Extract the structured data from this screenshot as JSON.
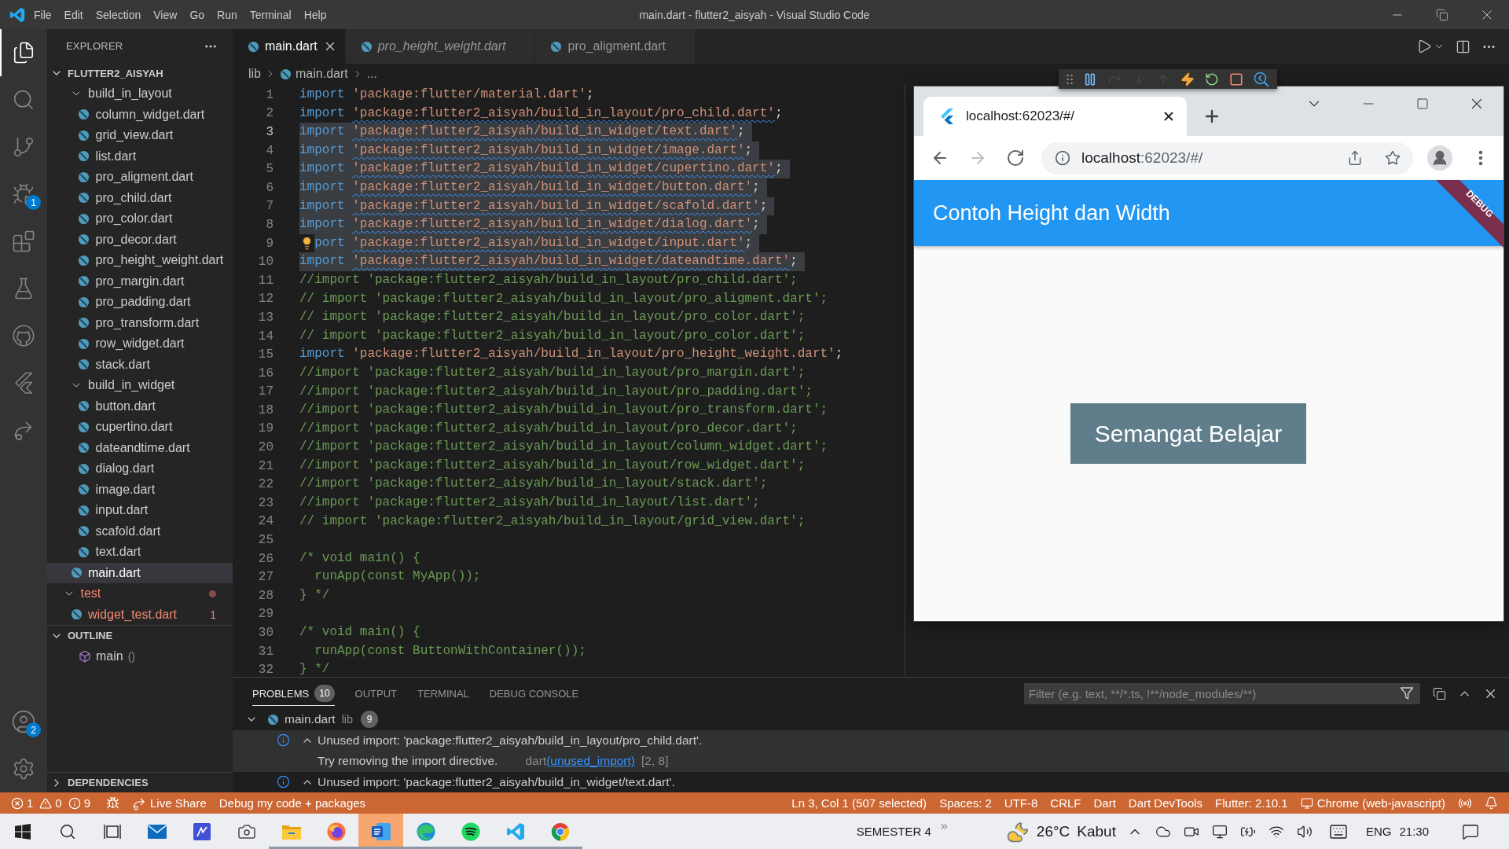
{
  "window": {
    "title": "main.dart - flutter2_aisyah - Visual Studio Code"
  },
  "menu": [
    "File",
    "Edit",
    "Selection",
    "View",
    "Go",
    "Run",
    "Terminal",
    "Help"
  ],
  "activity_bar": [
    {
      "kind": "explorer",
      "selected": true
    },
    {
      "kind": "search",
      "selected": false
    },
    {
      "kind": "source_control",
      "selected": false
    },
    {
      "kind": "run_debug",
      "selected": false,
      "badge": "1"
    },
    {
      "kind": "extensions",
      "selected": false
    },
    {
      "kind": "testing",
      "selected": false
    },
    {
      "kind": "github",
      "selected": false
    },
    {
      "kind": "flutter",
      "selected": false
    },
    {
      "kind": "live_share",
      "selected": false
    }
  ],
  "activity_bar_bottom": [
    {
      "kind": "accounts",
      "badge": "2"
    },
    {
      "kind": "manage"
    }
  ],
  "explorer": {
    "title": "EXPLORER",
    "project": {
      "label": "FLUTTER2_AISYAH",
      "expanded": true
    },
    "tree": [
      {
        "children": [
          {
            "label": "build_in_layout",
            "kind": "folder",
            "expanded": true,
            "selected": false,
            "error": false,
            "children": [
              {
                "label": "column_widget.dart",
                "kind": "file",
                "selected": false,
                "error": false
              },
              {
                "label": "grid_view.dart",
                "kind": "file",
                "selected": false,
                "error": false
              },
              {
                "label": "list.dart",
                "kind": "file",
                "selected": false,
                "error": false
              },
              {
                "label": "pro_aligment.dart",
                "kind": "file",
                "selected": false,
                "error": false
              },
              {
                "label": "pro_child.dart",
                "kind": "file",
                "selected": false,
                "error": false
              },
              {
                "label": "pro_color.dart",
                "kind": "file",
                "selected": false,
                "error": false
              },
              {
                "label": "pro_decor.dart",
                "kind": "file",
                "selected": false,
                "error": false
              },
              {
                "label": "pro_height_weight.dart",
                "kind": "file",
                "selected": false,
                "error": false
              },
              {
                "label": "pro_margin.dart",
                "kind": "file",
                "selected": false,
                "error": false
              },
              {
                "label": "pro_padding.dart",
                "kind": "file",
                "selected": false,
                "error": false
              },
              {
                "label": "pro_transform.dart",
                "kind": "file",
                "selected": false,
                "error": false
              },
              {
                "label": "row_widget.dart",
                "kind": "file",
                "selected": false,
                "error": false
              },
              {
                "label": "stack.dart",
                "kind": "file",
                "selected": false,
                "error": false
              }
            ]
          },
          {
            "label": "build_in_widget",
            "kind": "folder",
            "expanded": true,
            "selected": false,
            "error": false,
            "children": [
              {
                "label": "button.dart",
                "kind": "file",
                "selected": false,
                "error": false
              },
              {
                "label": "cupertino.dart",
                "kind": "file",
                "selected": false,
                "error": false
              },
              {
                "label": "dateandtime.dart",
                "kind": "file",
                "selected": false,
                "error": false
              },
              {
                "label": "dialog.dart",
                "kind": "file",
                "selected": false,
                "error": false
              },
              {
                "label": "image.dart",
                "kind": "file",
                "selected": false,
                "error": false
              },
              {
                "label": "input.dart",
                "kind": "file",
                "selected": false,
                "error": false
              },
              {
                "label": "scafold.dart",
                "kind": "file",
                "selected": false,
                "error": false
              },
              {
                "label": "text.dart",
                "kind": "file",
                "selected": false,
                "error": false
              }
            ]
          },
          {
            "label": "main.dart",
            "kind": "file",
            "selected": true,
            "error": false
          }
        ]
      },
      {
        "label": "test",
        "kind": "folder",
        "expanded": true,
        "selected": false,
        "error": true,
        "children": [
          {
            "label": "widget_test.dart",
            "kind": "file",
            "selected": false,
            "error": true,
            "problems": "1"
          }
        ]
      }
    ],
    "outline": {
      "title": "OUTLINE",
      "expanded": true,
      "items": [
        {
          "label": "main",
          "detail": "()"
        }
      ]
    },
    "dependencies": {
      "title": "DEPENDENCIES",
      "expanded": false
    }
  },
  "tabs": [
    {
      "label": "main.dart",
      "selected": true,
      "preview": false
    },
    {
      "label": "pro_height_weight.dart",
      "selected": false,
      "preview": true
    },
    {
      "label": "pro_aligment.dart",
      "selected": false,
      "preview": false
    }
  ],
  "breadcrumbs": [
    {
      "kind": "folder",
      "label": "lib"
    },
    {
      "kind": "file",
      "label": "main.dart"
    },
    {
      "kind": "symbol",
      "label": "..."
    }
  ],
  "debug_toolbar": [
    {
      "kind": "grip",
      "disabled": false
    },
    {
      "kind": "pause",
      "disabled": false
    },
    {
      "kind": "step_over",
      "disabled": true
    },
    {
      "kind": "step_into",
      "disabled": true
    },
    {
      "kind": "step_out",
      "disabled": true
    },
    {
      "kind": "hot_reload",
      "disabled": false
    },
    {
      "kind": "hot_restart",
      "disabled": false
    },
    {
      "kind": "stop",
      "disabled": false
    },
    {
      "kind": "devtools",
      "disabled": false
    }
  ],
  "editor": {
    "lines": [
      {
        "number": "1",
        "cursor": false,
        "selected": false,
        "squiggle": false,
        "lightbulb": false,
        "tokens": [
          {
            "kind": "keyword",
            "text": "import "
          },
          {
            "kind": "string",
            "text": "'package:flutter/material.dart'"
          },
          {
            "kind": "punct",
            "text": ";"
          }
        ]
      },
      {
        "number": "2",
        "cursor": false,
        "selected": false,
        "squiggle": true,
        "lightbulb": false,
        "tokens": [
          {
            "kind": "keyword",
            "text": "import "
          },
          {
            "kind": "string",
            "text": "'package:flutter2_aisyah/build_in_layout/pro_child.dart'"
          },
          {
            "kind": "punct",
            "text": ";"
          }
        ]
      },
      {
        "number": "3",
        "cursor": true,
        "selected": true,
        "squiggle": true,
        "lightbulb": false,
        "tokens": [
          {
            "kind": "keyword",
            "text": "import "
          },
          {
            "kind": "string",
            "text": "'package:flutter2_aisyah/build_in_widget/text.dart'"
          },
          {
            "kind": "punct",
            "text": ";"
          }
        ]
      },
      {
        "number": "4",
        "cursor": false,
        "selected": true,
        "squiggle": true,
        "lightbulb": false,
        "tokens": [
          {
            "kind": "keyword",
            "text": "import "
          },
          {
            "kind": "string",
            "text": "'package:flutter2_aisyah/build_in_widget/image.dart'"
          },
          {
            "kind": "punct",
            "text": ";"
          }
        ]
      },
      {
        "number": "5",
        "cursor": false,
        "selected": true,
        "squiggle": true,
        "lightbulb": false,
        "tokens": [
          {
            "kind": "keyword",
            "text": "import "
          },
          {
            "kind": "string",
            "text": "'package:flutter2_aisyah/build_in_widget/cupertino.dart'"
          },
          {
            "kind": "punct",
            "text": ";"
          }
        ]
      },
      {
        "number": "6",
        "cursor": false,
        "selected": true,
        "squiggle": true,
        "lightbulb": false,
        "tokens": [
          {
            "kind": "keyword",
            "text": "import "
          },
          {
            "kind": "string",
            "text": "'package:flutter2_aisyah/build_in_widget/button.dart'"
          },
          {
            "kind": "punct",
            "text": ";"
          }
        ]
      },
      {
        "number": "7",
        "cursor": false,
        "selected": true,
        "squiggle": true,
        "lightbulb": false,
        "tokens": [
          {
            "kind": "keyword",
            "text": "import "
          },
          {
            "kind": "string",
            "text": "'package:flutter2_aisyah/build_in_widget/scafold.dart'"
          },
          {
            "kind": "punct",
            "text": ";"
          }
        ]
      },
      {
        "number": "8",
        "cursor": false,
        "selected": true,
        "squiggle": true,
        "lightbulb": false,
        "tokens": [
          {
            "kind": "keyword",
            "text": "import "
          },
          {
            "kind": "string",
            "text": "'package:flutter2_aisyah/build_in_widget/dialog.dart'"
          },
          {
            "kind": "punct",
            "text": ";"
          }
        ]
      },
      {
        "number": "9",
        "cursor": false,
        "selected": true,
        "squiggle": true,
        "lightbulb": true,
        "tokens": [
          {
            "kind": "keyword",
            "text": "port "
          },
          {
            "kind": "string",
            "text": "'package:flutter2_aisyah/build_in_widget/input.dart'"
          },
          {
            "kind": "punct",
            "text": ";"
          }
        ]
      },
      {
        "number": "10",
        "cursor": false,
        "selected": true,
        "squiggle": true,
        "lightbulb": false,
        "tokens": [
          {
            "kind": "keyword",
            "text": "import "
          },
          {
            "kind": "string",
            "text": "'package:flutter2_aisyah/build_in_widget/dateandtime.dart'"
          },
          {
            "kind": "punct",
            "text": ";"
          }
        ]
      },
      {
        "number": "11",
        "cursor": false,
        "selected": false,
        "squiggle": false,
        "lightbulb": false,
        "tokens": [
          {
            "kind": "comment",
            "text": "//import 'package:flutter2_aisyah/build_in_layout/pro_child.dart';"
          }
        ]
      },
      {
        "number": "12",
        "cursor": false,
        "selected": false,
        "squiggle": false,
        "lightbulb": false,
        "tokens": [
          {
            "kind": "comment",
            "text": "// import 'package:flutter2_aisyah/build_in_layout/pro_aligment.dart';"
          }
        ]
      },
      {
        "number": "13",
        "cursor": false,
        "selected": false,
        "squiggle": false,
        "lightbulb": false,
        "tokens": [
          {
            "kind": "comment",
            "text": "// import 'package:flutter2_aisyah/build_in_layout/pro_color.dart';"
          }
        ]
      },
      {
        "number": "14",
        "cursor": false,
        "selected": false,
        "squiggle": false,
        "lightbulb": false,
        "tokens": [
          {
            "kind": "comment",
            "text": "// import 'package:flutter2_aisyah/build_in_layout/pro_color.dart';"
          }
        ]
      },
      {
        "number": "15",
        "cursor": false,
        "selected": false,
        "squiggle": false,
        "lightbulb": false,
        "tokens": [
          {
            "kind": "keyword",
            "text": "import "
          },
          {
            "kind": "string",
            "text": "'package:flutter2_aisyah/build_in_layout/pro_height_weight.dart'"
          },
          {
            "kind": "punct",
            "text": ";"
          }
        ]
      },
      {
        "number": "16",
        "cursor": false,
        "selected": false,
        "squiggle": false,
        "lightbulb": false,
        "tokens": [
          {
            "kind": "comment",
            "text": "//import 'package:flutter2_aisyah/build_in_layout/pro_margin.dart';"
          }
        ]
      },
      {
        "number": "17",
        "cursor": false,
        "selected": false,
        "squiggle": false,
        "lightbulb": false,
        "tokens": [
          {
            "kind": "comment",
            "text": "//import 'package:flutter2_aisyah/build_in_layout/pro_padding.dart';"
          }
        ]
      },
      {
        "number": "18",
        "cursor": false,
        "selected": false,
        "squiggle": false,
        "lightbulb": false,
        "tokens": [
          {
            "kind": "comment",
            "text": "//import 'package:flutter2_aisyah/build_in_layout/pro_transform.dart';"
          }
        ]
      },
      {
        "number": "19",
        "cursor": false,
        "selected": false,
        "squiggle": false,
        "lightbulb": false,
        "tokens": [
          {
            "kind": "comment",
            "text": "//import 'package:flutter2_aisyah/build_in_layout/pro_decor.dart';"
          }
        ]
      },
      {
        "number": "20",
        "cursor": false,
        "selected": false,
        "squiggle": false,
        "lightbulb": false,
        "tokens": [
          {
            "kind": "comment",
            "text": "//import 'package:flutter2_aisyah/build_in_layout/column_widget.dart';"
          }
        ]
      },
      {
        "number": "21",
        "cursor": false,
        "selected": false,
        "squiggle": false,
        "lightbulb": false,
        "tokens": [
          {
            "kind": "comment",
            "text": "//import 'package:flutter2_aisyah/build_in_layout/row_widget.dart';"
          }
        ]
      },
      {
        "number": "22",
        "cursor": false,
        "selected": false,
        "squiggle": false,
        "lightbulb": false,
        "tokens": [
          {
            "kind": "comment",
            "text": "//import 'package:flutter2_aisyah/build_in_layout/stack.dart';"
          }
        ]
      },
      {
        "number": "23",
        "cursor": false,
        "selected": false,
        "squiggle": false,
        "lightbulb": false,
        "tokens": [
          {
            "kind": "comment",
            "text": "//import 'package:flutter2_aisyah/build_in_layout/list.dart';"
          }
        ]
      },
      {
        "number": "24",
        "cursor": false,
        "selected": false,
        "squiggle": false,
        "lightbulb": false,
        "tokens": [
          {
            "kind": "comment",
            "text": "// import 'package:flutter2_aisyah/build_in_layout/grid_view.dart';"
          }
        ]
      },
      {
        "number": "25",
        "cursor": false
      },
      {
        "number": "26",
        "cursor": false,
        "selected": false,
        "squiggle": false,
        "lightbulb": false,
        "tokens": [
          {
            "kind": "comment",
            "text": "/* void main() {"
          }
        ]
      },
      {
        "number": "27",
        "cursor": false,
        "selected": false,
        "squiggle": false,
        "lightbulb": false,
        "tokens": [
          {
            "kind": "comment",
            "text": "  runApp(const MyApp());"
          }
        ]
      },
      {
        "number": "28",
        "cursor": false,
        "selected": false,
        "squiggle": false,
        "lightbulb": false,
        "tokens": [
          {
            "kind": "comment",
            "text": "} */"
          }
        ]
      },
      {
        "number": "29",
        "cursor": false
      },
      {
        "number": "30",
        "cursor": false,
        "selected": false,
        "squiggle": false,
        "lightbulb": false,
        "tokens": [
          {
            "kind": "comment",
            "text": "/* void main() {"
          }
        ]
      },
      {
        "number": "31",
        "cursor": false,
        "selected": false,
        "squiggle": false,
        "lightbulb": false,
        "tokens": [
          {
            "kind": "comment",
            "text": "  runApp(const ButtonWithContainer());"
          }
        ]
      },
      {
        "number": "32",
        "cursor": false,
        "selected": false,
        "squiggle": false,
        "lightbulb": false,
        "tokens": [
          {
            "kind": "comment",
            "text": "} */"
          }
        ]
      }
    ]
  },
  "browser": {
    "tab": {
      "title": "localhost:62023/#/",
      "selected": true
    },
    "nav": [
      {
        "kind": "back",
        "disabled": false
      },
      {
        "kind": "forward",
        "disabled": true
      },
      {
        "kind": "reload",
        "disabled": false
      }
    ],
    "address": {
      "host": "localhost",
      "path": ":62023/#/"
    },
    "app": {
      "title": "Contoh Height dan Width",
      "banner": "DEBUG",
      "box_label": "Semangat Belajar"
    }
  },
  "panel": {
    "tabs": [
      {
        "label": "PROBLEMS",
        "badge": "10",
        "selected": true
      },
      {
        "label": "OUTPUT",
        "selected": false
      },
      {
        "label": "TERMINAL",
        "selected": false
      },
      {
        "label": "DEBUG CONSOLE",
        "selected": false
      }
    ],
    "filter": {
      "placeholder": "Filter (e.g. text, **/*.ts, !**/node_modules/**)"
    },
    "problems": [
      {
        "file": "main.dart",
        "folder": "lib",
        "count": "9",
        "expanded": true,
        "children": [
          {
            "kind": "info",
            "message": "Unused import: 'package:flutter2_aisyah/build_in_layout/pro_child.dart'.",
            "expanded": true,
            "selected": true,
            "detail": {
              "text": "Try removing the import directive.",
              "source": "dart",
              "code": "(unused_import)",
              "position": "[2, 8]"
            }
          },
          {
            "kind": "info",
            "message": "Unused import: 'package:flutter2_aisyah/build_in_widget/text.dart'.",
            "expanded": true,
            "selected": false
          }
        ]
      }
    ]
  },
  "status_bar": {
    "problems": {
      "errors": "1",
      "warnings": "0",
      "infos": "9"
    },
    "left": [
      {
        "kind": "debug"
      },
      {
        "kind": "live_share",
        "label": "Live Share"
      },
      {
        "kind": "text",
        "label": "Debug my code + packages"
      }
    ],
    "right": [
      {
        "kind": "text",
        "label": "Ln 3, Col 1 (507 selected)"
      },
      {
        "kind": "text",
        "label": "Spaces: 2"
      },
      {
        "kind": "text",
        "label": "UTF-8"
      },
      {
        "kind": "text",
        "label": "CRLF"
      },
      {
        "kind": "text",
        "label": "Dart"
      },
      {
        "kind": "text",
        "label": "Dart DevTools"
      },
      {
        "kind": "text",
        "label": "Flutter: 2.10.1"
      },
      {
        "kind": "device",
        "label": "Chrome (web-javascript)"
      },
      {
        "kind": "feedback"
      },
      {
        "kind": "notifications"
      }
    ]
  },
  "taskbar": {
    "apps": [
      {
        "kind": "start",
        "running": false,
        "attention": false
      },
      {
        "kind": "search",
        "running": false,
        "attention": false
      },
      {
        "kind": "task_view",
        "running": false,
        "attention": false
      },
      {
        "kind": "mail",
        "running": false,
        "attention": false
      },
      {
        "kind": "whiteboard",
        "running": false,
        "attention": false
      },
      {
        "kind": "camera",
        "running": false,
        "attention": false
      },
      {
        "kind": "files",
        "running": true,
        "attention": false
      },
      {
        "kind": "firefox",
        "running": true,
        "attention": false
      },
      {
        "kind": "word",
        "running": true,
        "attention": true
      },
      {
        "kind": "edge",
        "running": true,
        "attention": false
      },
      {
        "kind": "spotify",
        "running": true,
        "attention": false
      },
      {
        "kind": "vscode",
        "running": true,
        "attention": false
      },
      {
        "kind": "chrome",
        "running": true,
        "attention": false
      }
    ],
    "toolbar": "SEMESTER 4",
    "weather": {
      "temperature": "26°C",
      "condition": "Kabut"
    },
    "language": "ENG",
    "time": "21:30"
  }
}
